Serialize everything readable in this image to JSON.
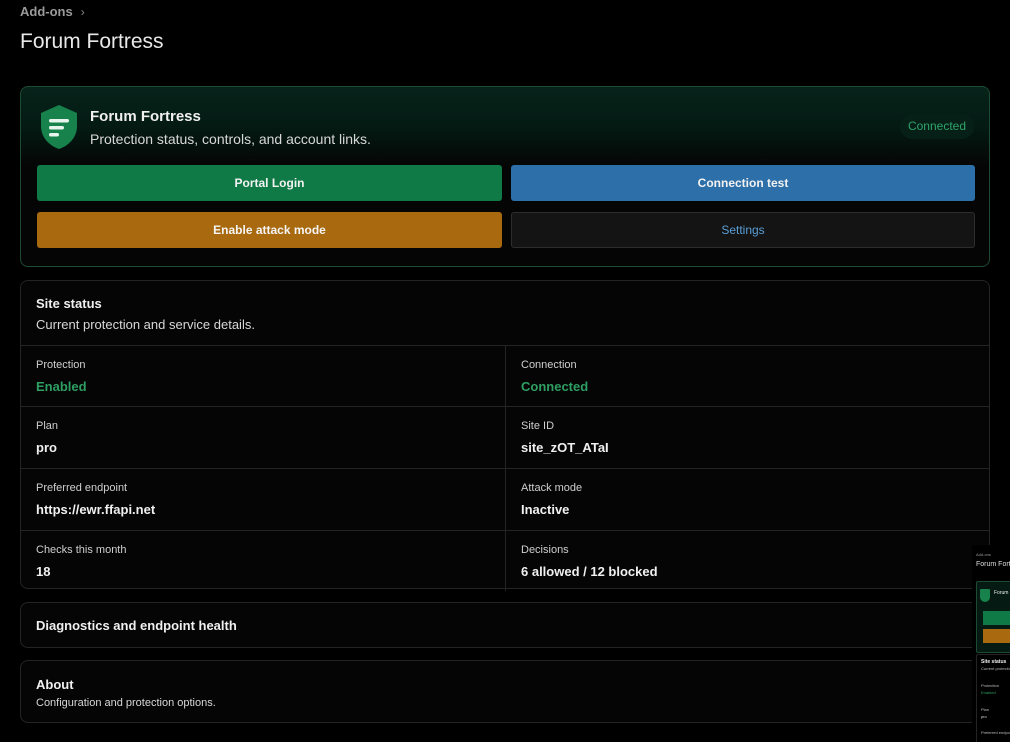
{
  "breadcrumb": {
    "label": "Add-ons",
    "separator": "›"
  },
  "page_title": "Forum Fortress",
  "hero": {
    "name": "Forum Fortress",
    "description": "Protection status, controls, and account links.",
    "badge": "Connected",
    "icon": "shield-icon",
    "buttons": {
      "portal_login": "Portal Login",
      "connection_test": "Connection test",
      "attack_mode": "Enable attack mode",
      "settings": "Settings"
    }
  },
  "site_status": {
    "title": "Site status",
    "description": "Current protection and service details.",
    "rows": [
      [
        {
          "label": "Protection",
          "value": "Enabled"
        },
        {
          "label": "Connection",
          "value": "Connected"
        }
      ],
      [
        {
          "label": "Plan",
          "value": "pro"
        },
        {
          "label": "Site ID",
          "value": "site_zOT_ATaI"
        }
      ],
      [
        {
          "label": "Preferred endpoint",
          "value": "https://ewr.ffapi.net"
        },
        {
          "label": "Attack mode",
          "value": "Inactive"
        }
      ],
      [
        {
          "label": "Checks this month",
          "value": "18"
        },
        {
          "label": "Decisions",
          "value": "6 allowed / 12 blocked"
        }
      ]
    ]
  },
  "diagnostics": {
    "title": "Diagnostics and endpoint health"
  },
  "about": {
    "title": "About",
    "description": "Configuration and protection options."
  },
  "colors": {
    "background": "#000000",
    "primary_green": "#0f7a46",
    "accent_blue": "#2d6fa8",
    "warning_orange": "#a8690f",
    "status_green": "#2e9e62",
    "link_blue": "#5a9fd8"
  }
}
